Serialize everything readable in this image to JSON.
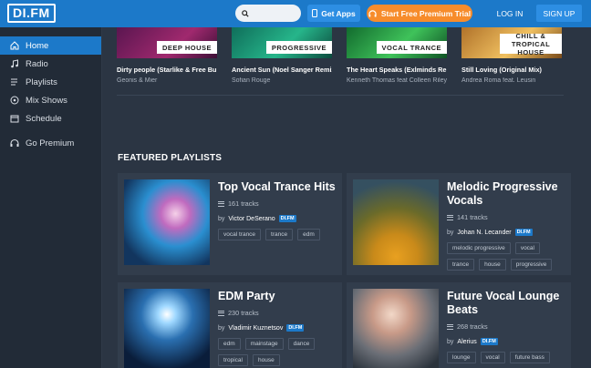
{
  "header": {
    "logo": "DI.FM",
    "search_placeholder": "",
    "get_apps": "Get Apps",
    "premium_trial": "Start Free Premium Trial",
    "login": "LOG IN",
    "signup": "SIGN UP"
  },
  "sidebar": {
    "items": [
      {
        "label": "Home",
        "icon": "home-icon"
      },
      {
        "label": "Radio",
        "icon": "music-note-icon"
      },
      {
        "label": "Playlists",
        "icon": "playlist-icon"
      },
      {
        "label": "Mix Shows",
        "icon": "mix-shows-icon"
      },
      {
        "label": "Schedule",
        "icon": "calendar-icon"
      },
      {
        "label": "Go Premium",
        "icon": "headphones-icon"
      }
    ]
  },
  "channels": [
    {
      "genre": "DEEP HOUSE",
      "track": "Dirty people (Starlike & Free Bu...",
      "artist": "Geonis & Mier",
      "color": "#7a1f5c"
    },
    {
      "genre": "PROGRESSIVE",
      "track": "Ancient Sun (Noel Sanger Remix)",
      "artist": "Sofian Rouge",
      "color": "#1aa06e"
    },
    {
      "genre": "VOCAL TRANCE",
      "track": "The Heart Speaks (Exlminds Re...",
      "artist": "Kenneth Thomas feat Colleen Riley",
      "color": "#1fa84a"
    },
    {
      "genre": "CHILL & TROPICAL HOUSE",
      "track": "Still Loving (Original Mix)",
      "artist": "Andrea Roma feat. Leusin",
      "color": "#e0a33a"
    }
  ],
  "featured": {
    "title": "FEATURED PLAYLISTS",
    "badge": "DI.FM",
    "by_prefix": "by",
    "playlists": [
      {
        "title": "Top Vocal Trance Hits",
        "tracks": "161 tracks",
        "author": "Victor DeSerano",
        "tags": [
          "vocal trance",
          "trance",
          "edm"
        ]
      },
      {
        "title": "Melodic Progressive Vocals",
        "tracks": "141 tracks",
        "author": "Johan N. Lecander",
        "tags": [
          "melodic progressive",
          "vocal",
          "trance",
          "house",
          "progressive"
        ]
      },
      {
        "title": "EDM Party",
        "tracks": "230 tracks",
        "author": "Vladimir Kuznetsov",
        "tags": [
          "edm",
          "mainstage",
          "dance",
          "tropical",
          "house"
        ]
      },
      {
        "title": "Future Vocal Lounge Beats",
        "tracks": "268 tracks",
        "author": "Alerius",
        "tags": [
          "lounge",
          "vocal",
          "future bass"
        ]
      }
    ]
  },
  "colors": {
    "topbar": "#1c79c9",
    "accent_orange": "#f78c2b",
    "background": "#2b3543",
    "sidebar": "#222b37"
  }
}
